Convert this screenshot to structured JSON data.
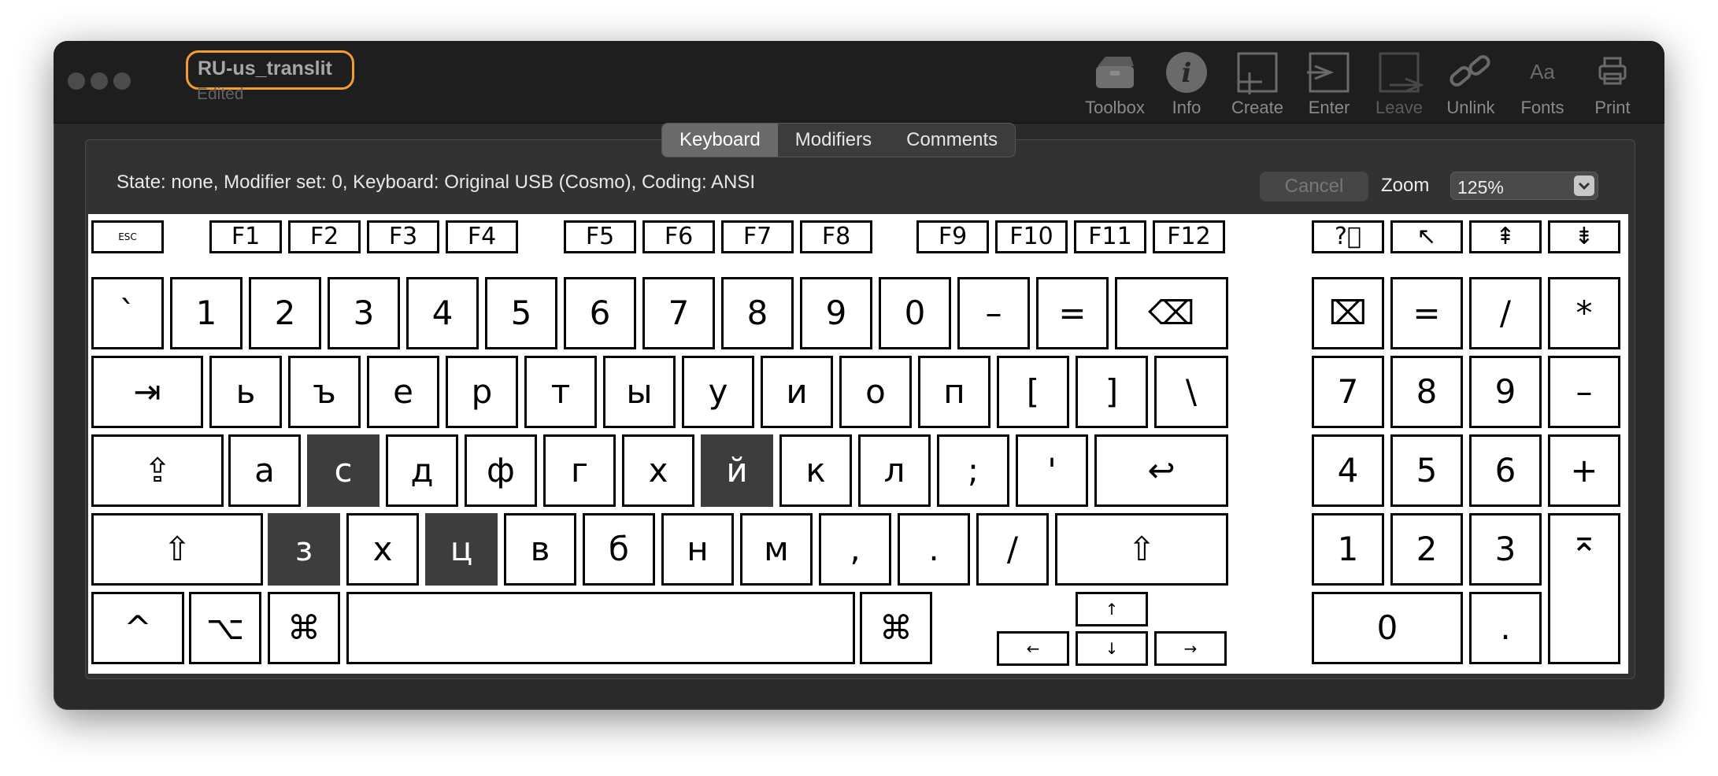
{
  "window": {
    "title": "RU-us_translit",
    "subtitle": "Edited"
  },
  "toolbar": [
    {
      "label": "Toolbox",
      "icon": "toolbox-icon",
      "enabled": true
    },
    {
      "label": "Info",
      "icon": "info-icon",
      "enabled": true
    },
    {
      "label": "Create",
      "icon": "create-icon",
      "enabled": true
    },
    {
      "label": "Enter",
      "icon": "enter-icon",
      "enabled": true
    },
    {
      "label": "Leave",
      "icon": "leave-icon",
      "enabled": false
    },
    {
      "label": "Unlink",
      "icon": "unlink-icon",
      "enabled": true
    },
    {
      "label": "Fonts",
      "icon": "fonts-icon",
      "enabled": true
    },
    {
      "label": "Print",
      "icon": "print-icon",
      "enabled": true
    }
  ],
  "tabs": [
    {
      "label": "Keyboard",
      "active": true
    },
    {
      "label": "Modifiers",
      "active": false
    },
    {
      "label": "Comments",
      "active": false
    }
  ],
  "status": "State: none, Modifier set: 0, Keyboard: Original USB (Cosmo), Coding: ANSI",
  "cancel_label": "Cancel",
  "zoom": {
    "label": "Zoom",
    "value": "125%"
  },
  "colors": {
    "highlight_key": "#3d3d3d",
    "title_outline": "#f39c32"
  },
  "keys": {
    "function_row": [
      "ESC",
      "F1",
      "F2",
      "F3",
      "F4",
      "F5",
      "F6",
      "F7",
      "F8",
      "F9",
      "F10",
      "F11",
      "F12",
      "?⃝",
      "↖",
      "⇞",
      "⇟"
    ],
    "number_row": [
      "`",
      "1",
      "2",
      "3",
      "4",
      "5",
      "6",
      "7",
      "8",
      "9",
      "0",
      "–",
      "=",
      "⌫",
      "⌧",
      "=",
      "/",
      "*"
    ],
    "top_row": [
      "⇥",
      "ь",
      "ъ",
      "е",
      "р",
      "т",
      "ы",
      "у",
      "и",
      "о",
      "п",
      "[",
      "]",
      "\\",
      "7",
      "8",
      "9",
      "–"
    ],
    "home_row": [
      "⇪",
      "а",
      "с",
      "д",
      "ф",
      "г",
      "х",
      "й",
      "к",
      "л",
      ";",
      "'",
      "↩",
      "4",
      "5",
      "6",
      "+"
    ],
    "bottom_row": [
      "⇧",
      "з",
      "х",
      "ц",
      "в",
      "б",
      "н",
      "м",
      ",",
      ".",
      "/",
      "⇧",
      "1",
      "2",
      "3",
      "⌅"
    ],
    "space_row": [
      "^",
      "⌥",
      "⌘",
      "",
      "⌘",
      "↑",
      "←",
      "↓",
      "→",
      "0",
      "."
    ],
    "highlighted": [
      "с",
      "й",
      "з",
      "ц"
    ]
  }
}
